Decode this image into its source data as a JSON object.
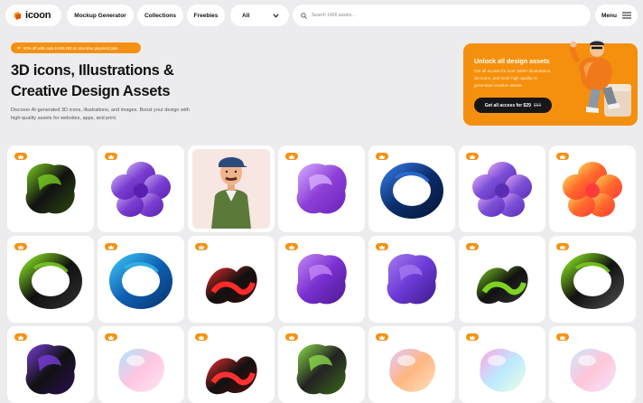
{
  "nav": {
    "logo": "icoon",
    "mockup_generator": "Mockup Generator",
    "collections": "Collections",
    "freebies": "Freebies",
    "all_select": "All",
    "search_placeholder": "Search 1406 assets...",
    "menu": "Menu"
  },
  "hero": {
    "promo": "50% off with code EARLY50 on one-time payment plan",
    "title_line1": "3D icons, Illustrations &",
    "title_line2": "Creative Design Assets",
    "description": "Discover AI-generated 3D icons, illustrations, and images. Boost your design with high-quality assets for websites, apps, and print."
  },
  "banner": {
    "title": "Unlock all design assets",
    "description": "Get all access for over 1500+ illustrations, 3D icons, and more high quality AI generated creative assets.",
    "button_label": "Get all access for $29",
    "old_price": "$59"
  },
  "colors": {
    "accent": "#f59112",
    "background": "#ececee",
    "card": "#ffffff",
    "dark": "#17171a"
  },
  "assets": [
    {
      "name": "abstract-black-green-3d-shape",
      "premium": true
    },
    {
      "name": "abstract-purple-flower-3d-shape",
      "premium": true
    },
    {
      "name": "cartoon-man-cap-illustration",
      "premium": false
    },
    {
      "name": "abstract-purple-glass-3d-shape",
      "premium": true
    },
    {
      "name": "abstract-blue-knot-3d-shape",
      "premium": true
    },
    {
      "name": "abstract-purple-flower-bloom-3d-shape",
      "premium": true
    },
    {
      "name": "abstract-orange-red-flower-3d-shape",
      "premium": true
    },
    {
      "name": "abstract-black-green-twist-3d-shape",
      "premium": true
    },
    {
      "name": "abstract-blue-torus-3d-shape",
      "premium": true
    },
    {
      "name": "abstract-red-black-wave-3d-shape",
      "premium": true
    },
    {
      "name": "abstract-purple-blob-3d-shape",
      "premium": true
    },
    {
      "name": "abstract-violet-knot-3d-shape",
      "premium": true
    },
    {
      "name": "abstract-black-green-curl-3d-shape",
      "premium": true
    },
    {
      "name": "abstract-green-black-ring-3d-shape",
      "premium": true
    },
    {
      "name": "abstract-black-purple-3d-shape",
      "premium": true
    },
    {
      "name": "abstract-pastel-blob-3d-shape",
      "premium": true
    },
    {
      "name": "abstract-red-black-swirl-3d-shape",
      "premium": true
    },
    {
      "name": "abstract-green-black-splash-3d-shape",
      "premium": true
    },
    {
      "name": "abstract-orange-pastel-blob-3d-shape",
      "premium": true
    },
    {
      "name": "abstract-holographic-blob-3d-shape",
      "premium": true
    },
    {
      "name": "abstract-pink-pastel-3d-shape",
      "premium": true
    }
  ]
}
